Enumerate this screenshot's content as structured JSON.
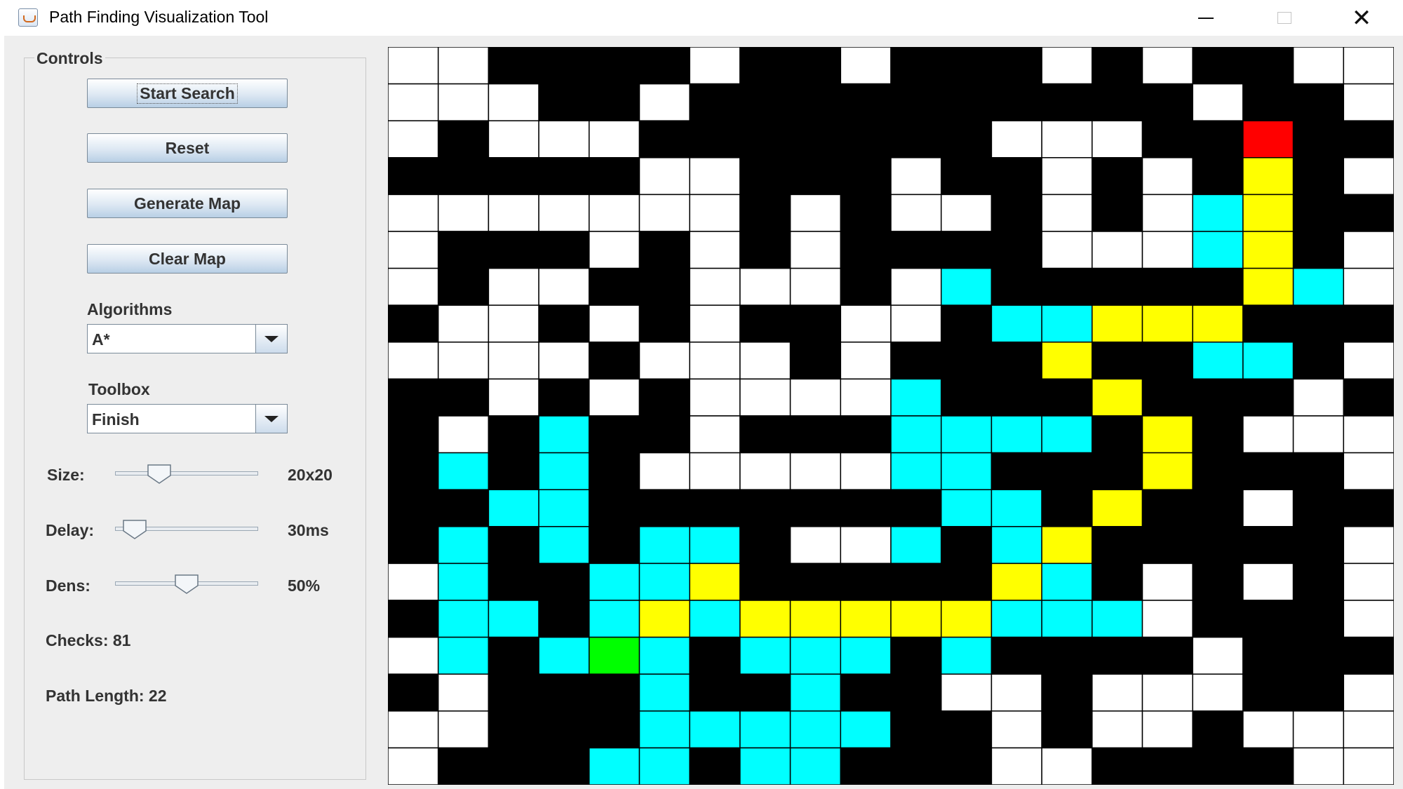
{
  "window": {
    "title": "Path Finding Visualization Tool",
    "controls": {
      "minimize": "minimize-icon",
      "maximize": "maximize-icon",
      "close": "close-icon"
    }
  },
  "controls": {
    "title": "Controls",
    "buttons": {
      "start": "Start Search",
      "reset": "Reset",
      "generate": "Generate Map",
      "clear": "Clear Map"
    },
    "algorithms": {
      "label": "Algorithms",
      "selected": "A*"
    },
    "toolbox": {
      "label": "Toolbox",
      "selected": "Finish"
    },
    "size": {
      "label": "Size:",
      "value_text": "20x20",
      "level": 0.27
    },
    "delay": {
      "label": "Delay:",
      "value_text": "30ms",
      "level": 0.06
    },
    "density": {
      "label": "Dens:",
      "value_text": "50%",
      "level": 0.5
    },
    "checks": "Checks: 81",
    "path_length": "Path Length: 22"
  },
  "grid": {
    "columns": 20,
    "rows": 20,
    "legend": {
      "W": "open",
      "B": "wall",
      "C": "checked",
      "Y": "path",
      "S": "start",
      "F": "finish"
    },
    "colors": {
      "W": "#ffffff",
      "B": "#000000",
      "C": "#00ffff",
      "Y": "#ffff00",
      "S": "#00ff00",
      "F": "#ff0000",
      "line": "#000000"
    },
    "cells": [
      "WWBBBBWBBWBBBWBWBBWW",
      "WWWBBWBBBBBBBBBBWBBW",
      "WBWWWBBBBBBBWWWBBFBB",
      "BBBBBWWBBBWBBWBWBYBW",
      "WWWWWWWBWBWWBWBWCYBB",
      "WBBBWBWBWBBBBWWWCYBW",
      "WBWWBBWWWBWCBBBBBYCW",
      "BWWBWBWBBWWBCCYYYBBB",
      "WWWWBWWWBWBBBYBBCCBW",
      "BBWBWBWWWWCBBBYBBBWB",
      "BWBCBBWBBBCCCCBYBWWW",
      "BCBCBWWWWWCCBBBYBBBW",
      "BBCCBBBBBBBCCBYBBWBB",
      "BCBCBCCBWWCBCYBBBBBW",
      "WCBBCCYBBBBBYCBWBWBW",
      "BCCBCYCYYYYYCCCWBBBW",
      "WCBCSCBCCCBCBBBBWBBB",
      "BWBBBCBBCBBWWBWWWBBW",
      "WWBBBCCCCCBBWBWWBWWW",
      "WBBBCCBCCBBBWWBBBBWW"
    ]
  }
}
